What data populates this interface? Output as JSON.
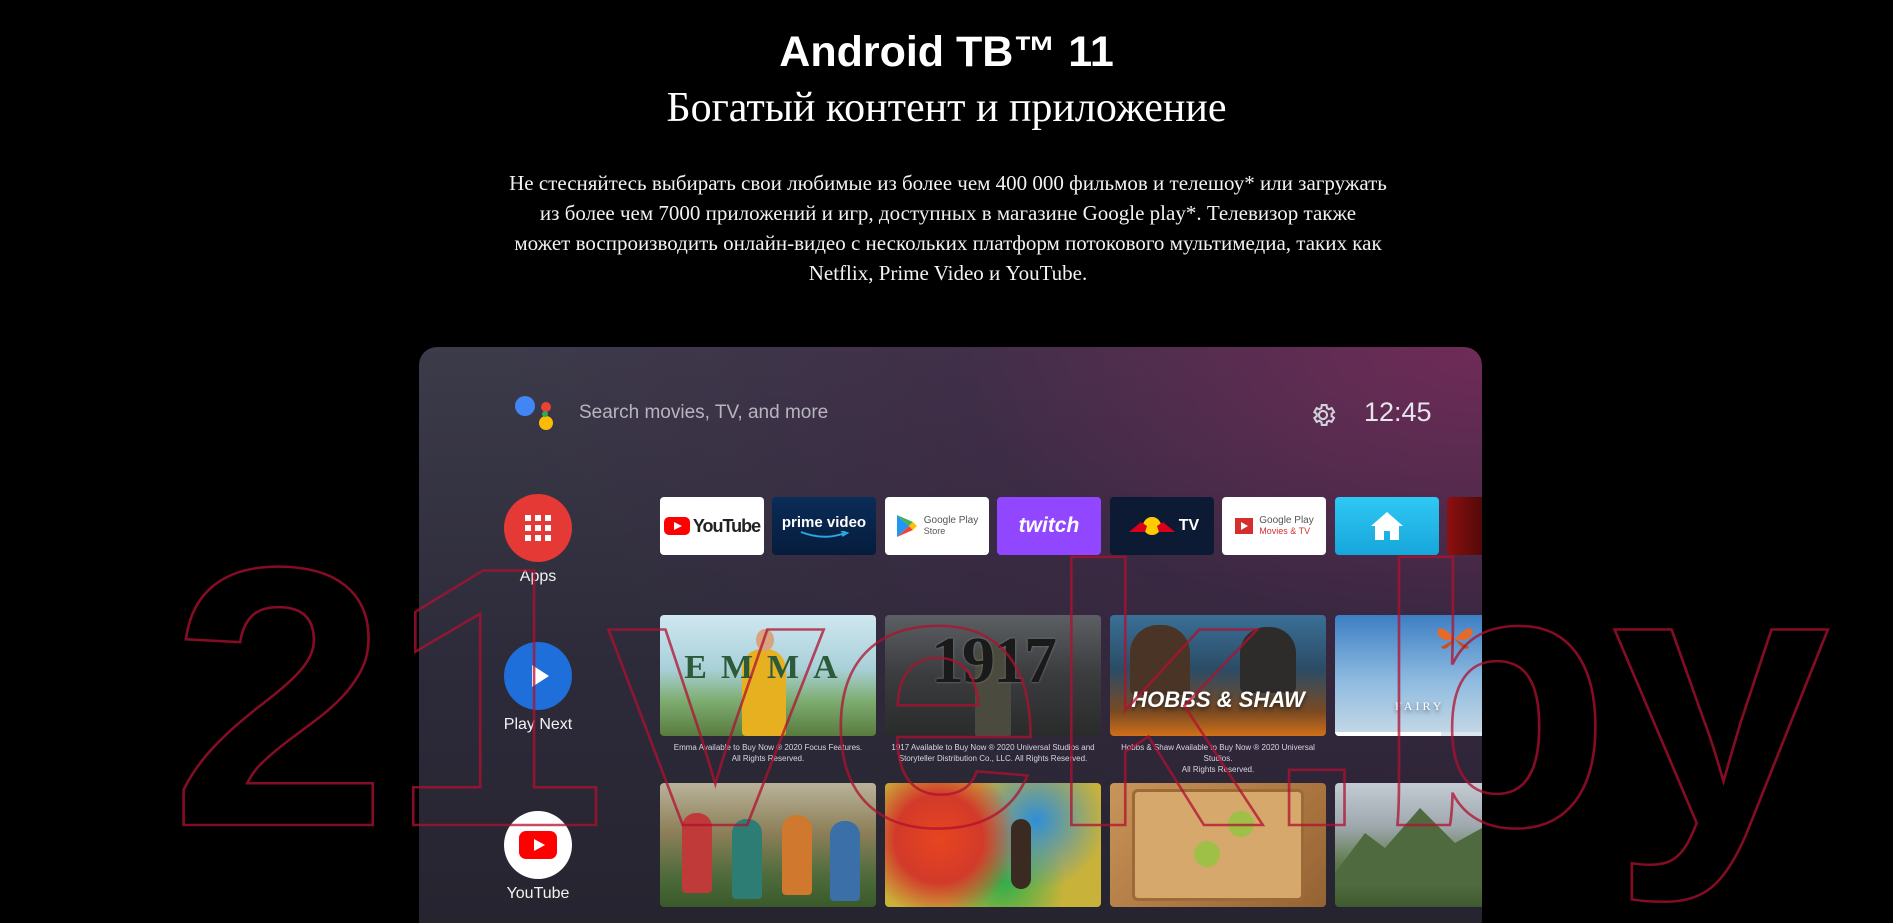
{
  "heading": {
    "title": "Android ТВ™ 11",
    "subtitle": "Богатый контент и приложение",
    "description_lines": [
      "Не стесняйтесь выбирать свои любимые из более чем 400 000 фильмов и телешоу* или загружать",
      "из более чем 7000 приложений и игр, доступных в магазине Google play*. Телевизор также",
      "может воспроизводить онлайн-видео с нескольких платформ потокового мультимедиа, таких как",
      "Netflix, Prime Video и YouTube."
    ]
  },
  "watermark": "21vek.by",
  "tv": {
    "search_placeholder": "Search movies, TV, and more",
    "clock": "12:45",
    "side": [
      {
        "label": "Apps",
        "icon": "apps-grid-icon",
        "color": "#e53935"
      },
      {
        "label": "Play Next",
        "icon": "play-icon",
        "color": "#1e6fd9"
      },
      {
        "label": "YouTube",
        "icon": "youtube-icon",
        "color": "#ffffff"
      }
    ],
    "apps": [
      {
        "label": "YouTube"
      },
      {
        "label": "prime video"
      },
      {
        "label": "Google Play",
        "sub": "Store"
      },
      {
        "label": "twitch"
      },
      {
        "label": "TV"
      },
      {
        "label": "Google Play",
        "sub": "Movies & TV"
      },
      {
        "label": "home"
      }
    ],
    "play_next": [
      {
        "title": "EMMA",
        "caption": [
          "Emma Available to Buy Now ® 2020 Focus Features.",
          "All Rights Reserved."
        ]
      },
      {
        "title": "1917",
        "caption": [
          "1917 Available to Buy Now ® 2020 Universal Studios and",
          "Storyteller Distribution Co., LLC. All Rights Reserved."
        ]
      },
      {
        "title": "HOBBS & SHAW",
        "caption": [
          "Hobbs & Shaw Available to Buy Now ® 2020 Universal Studios.",
          "All Rights Reserved."
        ]
      },
      {
        "title": "FAIRY",
        "caption": []
      }
    ],
    "youtube_row": [
      {
        "name": "dancers"
      },
      {
        "name": "color-run"
      },
      {
        "name": "cooking"
      },
      {
        "name": "mountains"
      }
    ]
  }
}
